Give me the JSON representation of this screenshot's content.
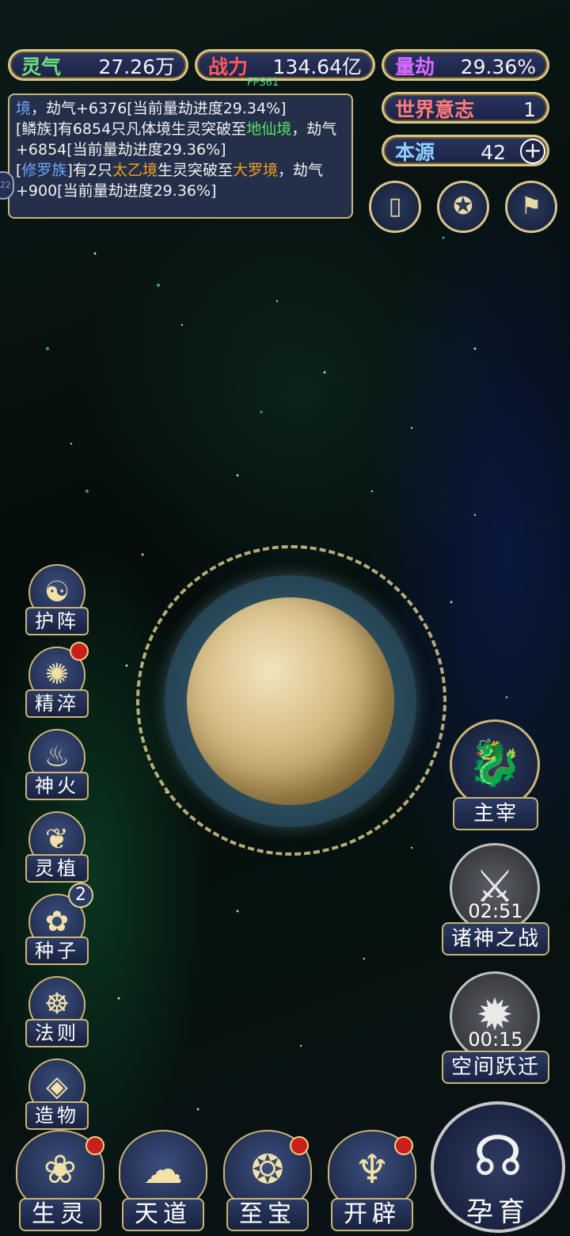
{
  "hud": {
    "lingqi": {
      "label": "灵气",
      "value": "27.26万"
    },
    "zhanli": {
      "label": "战力",
      "value": "134.64亿"
    },
    "liangjie": {
      "label": "量劫",
      "value": "29.36%"
    },
    "shijie": {
      "label": "世界意志",
      "value": "1"
    },
    "benyuan": {
      "label": "本源",
      "value": "42"
    },
    "fps": "FPS61"
  },
  "log": {
    "line1_a": "境",
    "line1_b": "，劫气+6376[当前量劫进度29.34%]",
    "line2_a": "[鳞族]有6854只凡体境生灵突破至",
    "line2_b": "地仙境",
    "line2_c": "，劫气+6854[当前量劫进度29.36%]",
    "line3_a": "[",
    "line3_b": "修罗族",
    "line3_c": "]有2只",
    "line3_d": "太乙境",
    "line3_e": "生灵突破至",
    "line3_f": "大罗境",
    "line3_g": "，劫气+900[当前量劫进度29.36%]",
    "edge_badge": "22"
  },
  "side_menu": [
    {
      "label": "护阵",
      "icon": "yinyang-icon",
      "glyph": "☯"
    },
    {
      "label": "精淬",
      "icon": "flame-lotus-icon",
      "glyph": "✺"
    },
    {
      "label": "神火",
      "icon": "fire-icon",
      "glyph": "♨"
    },
    {
      "label": "灵植",
      "icon": "plant-icon",
      "glyph": "❦"
    },
    {
      "label": "种子",
      "icon": "seed-flower-icon",
      "glyph": "✿",
      "badge": "2"
    },
    {
      "label": "法则",
      "icon": "mask-icon",
      "glyph": "☸"
    },
    {
      "label": "造物",
      "icon": "diamond-icon",
      "glyph": "◈"
    }
  ],
  "right_menu": {
    "zhuzai": {
      "label": "主宰",
      "glyph": "🐉"
    },
    "zhushen": {
      "label": "诸神之战",
      "timer": "02:51",
      "glyph": "⚔"
    },
    "kongjian": {
      "label": "空间跃迁",
      "timer": "00:15",
      "glyph": "✹"
    }
  },
  "bottom_menu": [
    {
      "label": "生灵",
      "glyph": "❀"
    },
    {
      "label": "天道",
      "glyph": "☁"
    },
    {
      "label": "至宝",
      "glyph": "❂"
    },
    {
      "label": "开辟",
      "glyph": "♆"
    }
  ],
  "yunyu": {
    "label": "孕育",
    "glyph": "☊"
  },
  "top_icons": {
    "cards": "▯",
    "portal": "✪",
    "scroll": "⚑"
  },
  "colors": {
    "gold": "#d8c58a",
    "panel": "#2b3561",
    "badge_red": "#c91f1f"
  }
}
